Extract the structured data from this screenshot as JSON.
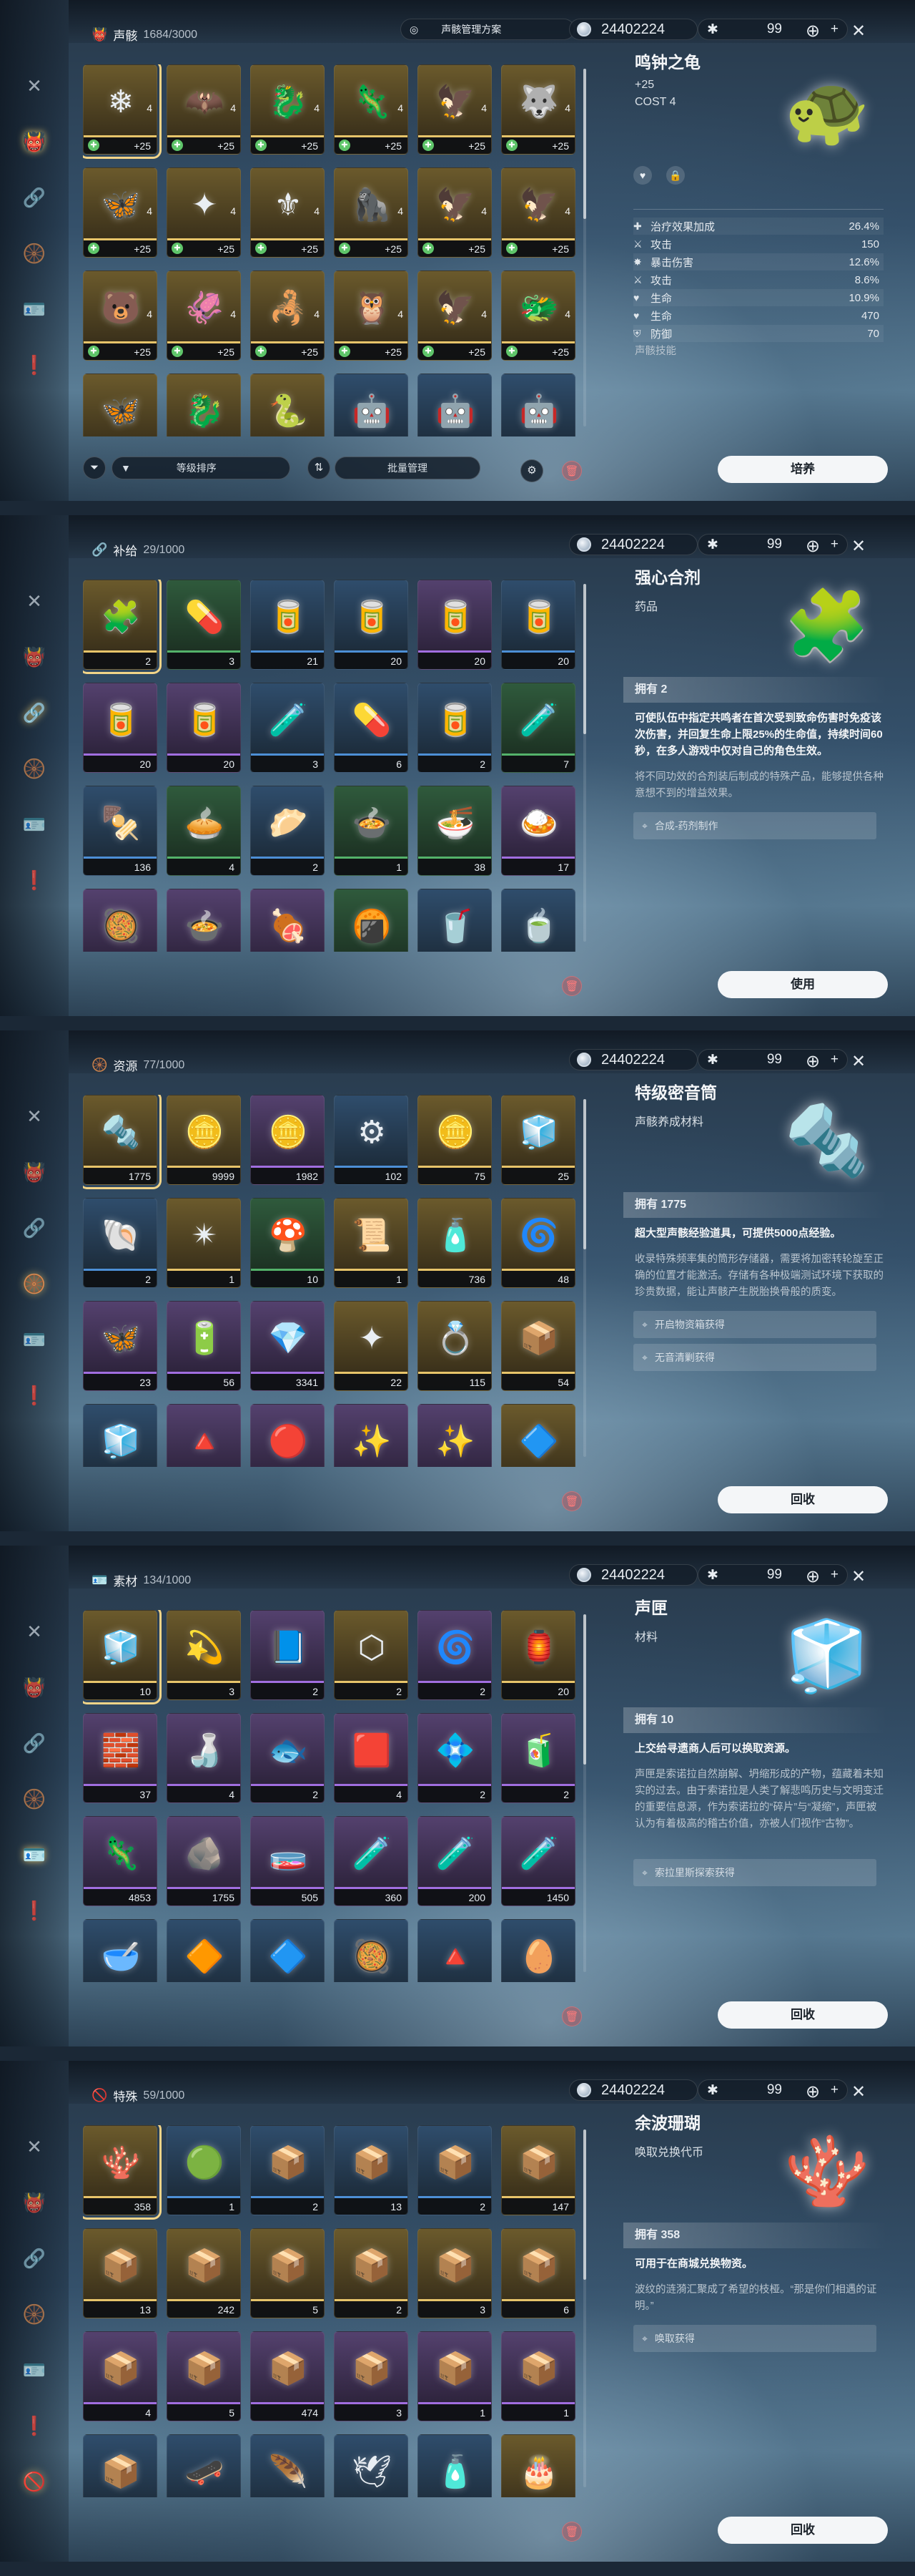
{
  "currency_amount": "24402224",
  "tuner_count": "99",
  "tuner_plus": "+",
  "panels": [
    {
      "category_label": "声骸",
      "count": "1684/3000",
      "scheme_label": "声骸管理方案",
      "sort_label": "等级排序",
      "batch_label": "批量管理",
      "action_label": "培养",
      "detail": {
        "name": "鸣钟之龟",
        "level": "+25",
        "cost_label": "COST",
        "cost_value": "4",
        "skill_label": "声骸技能",
        "stats": [
          {
            "icon": "heal-icon",
            "label": "治疗效果加成",
            "value": "26.4%"
          },
          {
            "icon": "sword-icon",
            "label": "攻击",
            "value": "150"
          },
          {
            "icon": "crit-icon",
            "label": "暴击伤害",
            "value": "12.6%"
          },
          {
            "icon": "sword-icon",
            "label": "攻击",
            "value": "8.6%"
          },
          {
            "icon": "heart-icon",
            "label": "生命",
            "value": "10.9%"
          },
          {
            "icon": "heart-icon",
            "label": "生命",
            "value": "470"
          },
          {
            "icon": "shield-icon",
            "label": "防御",
            "value": "70"
          }
        ]
      },
      "items": [
        {
          "level": "+25",
          "cost": "4",
          "rarity": 5,
          "glyph": "❄"
        },
        {
          "level": "+25",
          "cost": "4",
          "rarity": 5,
          "glyph": "🦇"
        },
        {
          "level": "+25",
          "cost": "4",
          "rarity": 5,
          "glyph": "🐉"
        },
        {
          "level": "+25",
          "cost": "4",
          "rarity": 5,
          "glyph": "🦎"
        },
        {
          "level": "+25",
          "cost": "4",
          "rarity": 5,
          "glyph": "🦅"
        },
        {
          "level": "+25",
          "cost": "4",
          "rarity": 5,
          "glyph": "🐺"
        },
        {
          "level": "+25",
          "cost": "4",
          "rarity": 5,
          "glyph": "🦋"
        },
        {
          "level": "+25",
          "cost": "4",
          "rarity": 5,
          "glyph": "✦"
        },
        {
          "level": "+25",
          "cost": "4",
          "rarity": 5,
          "glyph": "⚜"
        },
        {
          "level": "+25",
          "cost": "4",
          "rarity": 5,
          "glyph": "🦍"
        },
        {
          "level": "+25",
          "cost": "4",
          "rarity": 5,
          "glyph": "🦅"
        },
        {
          "level": "+25",
          "cost": "4",
          "rarity": 5,
          "glyph": "🦅"
        },
        {
          "level": "+25",
          "cost": "4",
          "rarity": 5,
          "glyph": "🐻"
        },
        {
          "level": "+25",
          "cost": "4",
          "rarity": 5,
          "glyph": "🦑"
        },
        {
          "level": "+25",
          "cost": "4",
          "rarity": 5,
          "glyph": "🦂"
        },
        {
          "level": "+25",
          "cost": "4",
          "rarity": 5,
          "glyph": "🦉"
        },
        {
          "level": "+25",
          "cost": "4",
          "rarity": 5,
          "glyph": "🦅"
        },
        {
          "level": "+25",
          "cost": "4",
          "rarity": 5,
          "glyph": "🐲"
        },
        {
          "level": "",
          "cost": "",
          "rarity": 5,
          "glyph": "🦋"
        },
        {
          "level": "",
          "cost": "",
          "rarity": 5,
          "glyph": "🐉"
        },
        {
          "level": "",
          "cost": "",
          "rarity": 5,
          "glyph": "🐍"
        },
        {
          "level": "",
          "cost": "",
          "rarity": 3,
          "glyph": "🤖"
        },
        {
          "level": "",
          "cost": "",
          "rarity": 3,
          "glyph": "🤖"
        },
        {
          "level": "",
          "cost": "",
          "rarity": 3,
          "glyph": "🤖"
        }
      ]
    },
    {
      "category_label": "补给",
      "count": "29/1000",
      "action_label": "使用",
      "detail": {
        "name": "强心合剂",
        "subtitle": "药品",
        "owned": "拥有 2",
        "desc_main": "可使队伍中指定共鸣者在首次受到致命伤害时免疫该次伤害，并回复生命上限25%的生命值，持续时间60秒，在多人游戏中仅对自己的角色生效。",
        "desc_sub": "将不同功效的合剂装后制成的特殊产品，能够提供各种意想不到的增益效果。",
        "sources": [
          "合成-药剂制作"
        ]
      },
      "items": [
        {
          "count": "2",
          "rarity": 5,
          "glyph": "🧩"
        },
        {
          "count": "3",
          "rarity": 2,
          "glyph": "💊"
        },
        {
          "count": "21",
          "rarity": 3,
          "glyph": "🥫"
        },
        {
          "count": "20",
          "rarity": 3,
          "glyph": "🥫"
        },
        {
          "count": "20",
          "rarity": 4,
          "glyph": "🥫"
        },
        {
          "count": "20",
          "rarity": 3,
          "glyph": "🥫"
        },
        {
          "count": "20",
          "rarity": 4,
          "glyph": "🥫"
        },
        {
          "count": "20",
          "rarity": 4,
          "glyph": "🥫"
        },
        {
          "count": "3",
          "rarity": 3,
          "glyph": "🧪"
        },
        {
          "count": "6",
          "rarity": 3,
          "glyph": "💊"
        },
        {
          "count": "2",
          "rarity": 3,
          "glyph": "🥫"
        },
        {
          "count": "7",
          "rarity": 2,
          "glyph": "🧪"
        },
        {
          "count": "136",
          "rarity": 3,
          "glyph": "🍢"
        },
        {
          "count": "4",
          "rarity": 2,
          "glyph": "🥧"
        },
        {
          "count": "2",
          "rarity": 3,
          "glyph": "🥟"
        },
        {
          "count": "1",
          "rarity": 2,
          "glyph": "🍲"
        },
        {
          "count": "38",
          "rarity": 2,
          "glyph": "🍜"
        },
        {
          "count": "17",
          "rarity": 4,
          "glyph": "🍛"
        },
        {
          "count": "",
          "rarity": 4,
          "glyph": "🥘"
        },
        {
          "count": "",
          "rarity": 4,
          "glyph": "🍲"
        },
        {
          "count": "",
          "rarity": 4,
          "glyph": "🍖"
        },
        {
          "count": "",
          "rarity": 2,
          "glyph": "🍘"
        },
        {
          "count": "",
          "rarity": 3,
          "glyph": "🥤"
        },
        {
          "count": "",
          "rarity": 3,
          "glyph": "🍵"
        }
      ]
    },
    {
      "category_label": "资源",
      "count": "77/1000",
      "action_label": "回收",
      "detail": {
        "name": "特级密音筒",
        "subtitle": "声骸养成材料",
        "owned": "拥有 1775",
        "desc_main": "超大型声骸经验道具，可提供5000点经验。",
        "desc_sub": "收录特殊频率集的筒形存储器，需要将加密转轮旋至正确的位置才能激活。存储有各种极端测试环境下获取的珍贵数据，能让声骸产生脱胎换骨般的质变。",
        "sources": [
          "开启物资箱获得",
          "无音清剿获得"
        ]
      },
      "items": [
        {
          "count": "1775",
          "rarity": 5,
          "glyph": "🔩"
        },
        {
          "count": "9999",
          "rarity": 5,
          "glyph": "🪙"
        },
        {
          "count": "1982",
          "rarity": 4,
          "glyph": "🪙"
        },
        {
          "count": "102",
          "rarity": 3,
          "glyph": "⚙"
        },
        {
          "count": "75",
          "rarity": 5,
          "glyph": "🪙"
        },
        {
          "count": "25",
          "rarity": 5,
          "glyph": "🧊"
        },
        {
          "count": "2",
          "rarity": 3,
          "glyph": "🐚"
        },
        {
          "count": "1",
          "rarity": 5,
          "glyph": "✴"
        },
        {
          "count": "10",
          "rarity": 2,
          "glyph": "🍄"
        },
        {
          "count": "1",
          "rarity": 5,
          "glyph": "📜"
        },
        {
          "count": "736",
          "rarity": 5,
          "glyph": "🧴"
        },
        {
          "count": "48",
          "rarity": 5,
          "glyph": "🌀"
        },
        {
          "count": "23",
          "rarity": 4,
          "glyph": "🦋"
        },
        {
          "count": "56",
          "rarity": 4,
          "glyph": "🔋"
        },
        {
          "count": "3341",
          "rarity": 4,
          "glyph": "💎"
        },
        {
          "count": "22",
          "rarity": 5,
          "glyph": "✦"
        },
        {
          "count": "115",
          "rarity": 5,
          "glyph": "💍"
        },
        {
          "count": "54",
          "rarity": 5,
          "glyph": "📦"
        },
        {
          "count": "",
          "rarity": 3,
          "glyph": "🧊"
        },
        {
          "count": "",
          "rarity": 4,
          "glyph": "🔺"
        },
        {
          "count": "",
          "rarity": 4,
          "glyph": "🔴"
        },
        {
          "count": "",
          "rarity": 4,
          "glyph": "✨"
        },
        {
          "count": "",
          "rarity": 4,
          "glyph": "✨"
        },
        {
          "count": "",
          "rarity": 5,
          "glyph": "🔷"
        }
      ]
    },
    {
      "category_label": "素材",
      "count": "134/1000",
      "action_label": "回收",
      "detail": {
        "name": "声匣",
        "subtitle": "材料",
        "owned": "拥有 10",
        "desc_main": "上交给寻遗商人后可以换取资源。",
        "desc_sub": "声匣是索诺拉自然崩解、坍缩形成的产物，蕴藏着未知实的过去。由于索诺拉是人类了解悲鸣历史与文明变迁的重要信息源，作为索诺拉的“碎片”与“凝缩”，声匣被认为有着极高的稽古价值，亦被人们视作“古物”。",
        "sources": [
          "索拉里斯探索获得"
        ]
      },
      "items": [
        {
          "count": "10",
          "rarity": 5,
          "glyph": "🧊"
        },
        {
          "count": "3",
          "rarity": 5,
          "glyph": "💫"
        },
        {
          "count": "2",
          "rarity": 4,
          "glyph": "📘"
        },
        {
          "count": "2",
          "rarity": 5,
          "glyph": "⬡"
        },
        {
          "count": "2",
          "rarity": 4,
          "glyph": "🌀"
        },
        {
          "count": "20",
          "rarity": 5,
          "glyph": "🏮"
        },
        {
          "count": "37",
          "rarity": 4,
          "glyph": "🧱"
        },
        {
          "count": "4",
          "rarity": 4,
          "glyph": "🍶"
        },
        {
          "count": "2",
          "rarity": 4,
          "glyph": "🐟"
        },
        {
          "count": "4",
          "rarity": 4,
          "glyph": "🟥"
        },
        {
          "count": "2",
          "rarity": 4,
          "glyph": "💠"
        },
        {
          "count": "2",
          "rarity": 4,
          "glyph": "🧃"
        },
        {
          "count": "4853",
          "rarity": 4,
          "glyph": "🦎"
        },
        {
          "count": "1755",
          "rarity": 4,
          "glyph": "🪨"
        },
        {
          "count": "505",
          "rarity": 4,
          "glyph": "🧫"
        },
        {
          "count": "360",
          "rarity": 4,
          "glyph": "🧪"
        },
        {
          "count": "200",
          "rarity": 4,
          "glyph": "🧪"
        },
        {
          "count": "1450",
          "rarity": 4,
          "glyph": "🧪"
        },
        {
          "count": "",
          "rarity": 3,
          "glyph": "🥣"
        },
        {
          "count": "",
          "rarity": 3,
          "glyph": "🔶"
        },
        {
          "count": "",
          "rarity": 3,
          "glyph": "🔷"
        },
        {
          "count": "",
          "rarity": 3,
          "glyph": "🥘"
        },
        {
          "count": "",
          "rarity": 3,
          "glyph": "🔺"
        },
        {
          "count": "",
          "rarity": 3,
          "glyph": "🥚"
        }
      ]
    },
    {
      "category_label": "特殊",
      "count": "59/1000",
      "action_label": "回收",
      "detail": {
        "name": "余波珊瑚",
        "subtitle": "唤取兑换代币",
        "owned": "拥有 358",
        "desc_main": "可用于在商城兑换物资。",
        "desc_sub": "波纹的涟漪汇聚成了希望的枝桠。“那是你们相遇的证明。”",
        "sources": [
          "唤取获得"
        ]
      },
      "items": [
        {
          "count": "358",
          "rarity": 5,
          "glyph": "🪸"
        },
        {
          "count": "1",
          "rarity": 3,
          "glyph": "🟢"
        },
        {
          "count": "2",
          "rarity": 3,
          "glyph": "📦"
        },
        {
          "count": "13",
          "rarity": 3,
          "glyph": "📦"
        },
        {
          "count": "2",
          "rarity": 3,
          "glyph": "📦"
        },
        {
          "count": "147",
          "rarity": 5,
          "glyph": "📦"
        },
        {
          "count": "13",
          "rarity": 5,
          "glyph": "📦"
        },
        {
          "count": "242",
          "rarity": 5,
          "glyph": "📦"
        },
        {
          "count": "5",
          "rarity": 5,
          "glyph": "📦"
        },
        {
          "count": "2",
          "rarity": 5,
          "glyph": "📦"
        },
        {
          "count": "3",
          "rarity": 5,
          "glyph": "📦"
        },
        {
          "count": "6",
          "rarity": 5,
          "glyph": "📦"
        },
        {
          "count": "4",
          "rarity": 4,
          "glyph": "📦"
        },
        {
          "count": "5",
          "rarity": 4,
          "glyph": "📦"
        },
        {
          "count": "474",
          "rarity": 4,
          "glyph": "📦"
        },
        {
          "count": "3",
          "rarity": 4,
          "glyph": "📦"
        },
        {
          "count": "1",
          "rarity": 4,
          "glyph": "📦"
        },
        {
          "count": "1",
          "rarity": 4,
          "glyph": "📦"
        },
        {
          "count": "",
          "rarity": 3,
          "glyph": "📦"
        },
        {
          "count": "",
          "rarity": 3,
          "glyph": "🛹"
        },
        {
          "count": "",
          "rarity": 3,
          "glyph": "🪶"
        },
        {
          "count": "",
          "rarity": 3,
          "glyph": "🕊"
        },
        {
          "count": "",
          "rarity": 3,
          "glyph": "🧴"
        },
        {
          "count": "",
          "rarity": 5,
          "glyph": "🎂"
        }
      ]
    }
  ]
}
